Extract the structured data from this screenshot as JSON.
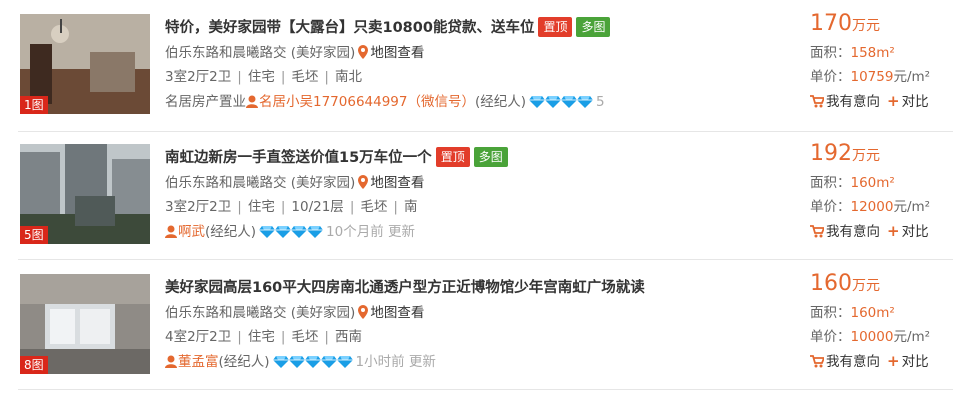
{
  "listings": [
    {
      "photo_count": "1图",
      "title": "特价，美好家园带【大露台】只卖10800能贷款、送车位",
      "tags": [
        "置顶",
        "多图"
      ],
      "location": "伯乐东路和晨曦路交 (美好家园)",
      "map_link": "地图查看",
      "attrs": [
        "3室2厅2卫",
        "住宅",
        "毛坯",
        "南北"
      ],
      "agency": "名居房产置业",
      "agent_name": "名居小吴17706644997（微信号）",
      "agent_role": "(经纪人)",
      "diamond_count": 4,
      "agent_extra": "5",
      "price": "170",
      "price_unit": "万元",
      "area_label": "面积：",
      "area": "158m²",
      "unit_price_label": "单价：",
      "unit_price": "10759",
      "unit_price_suffix": "元/m²",
      "interest_label": "我有意向",
      "compare_label": "对比"
    },
    {
      "photo_count": "5图",
      "title": "南虹边新房一手直签送价值15万车位一个",
      "tags": [
        "置顶",
        "多图"
      ],
      "location": "伯乐东路和晨曦路交 (美好家园)",
      "map_link": "地图查看",
      "attrs": [
        "3室2厅2卫",
        "住宅",
        "10/21层",
        "毛坯",
        "南"
      ],
      "agency": "",
      "agent_name": "啊武",
      "agent_role": "(经纪人)",
      "diamond_count": 4,
      "agent_extra": "10个月前 更新",
      "price": "192",
      "price_unit": "万元",
      "area_label": "面积：",
      "area": "160m²",
      "unit_price_label": "单价：",
      "unit_price": "12000",
      "unit_price_suffix": "元/m²",
      "interest_label": "我有意向",
      "compare_label": "对比"
    },
    {
      "photo_count": "8图",
      "title": "美好家园高层160平大四房南北通透户型方正近博物馆少年宫南虹广场就读",
      "tags": [],
      "location": "伯乐东路和晨曦路交 (美好家园)",
      "map_link": "地图查看",
      "attrs": [
        "4室2厅2卫",
        "住宅",
        "毛坯",
        "西南"
      ],
      "agency": "",
      "agent_name": "董孟富",
      "agent_role": "(经纪人)",
      "diamond_count": 5,
      "agent_extra": "1小时前 更新",
      "price": "160",
      "price_unit": "万元",
      "area_label": "面积：",
      "area": "160m²",
      "unit_price_label": "单价：",
      "unit_price": "10000",
      "unit_price_suffix": "元/m²",
      "interest_label": "我有意向",
      "compare_label": "对比"
    }
  ],
  "colors": {
    "accent": "#e4682f",
    "tag_top": "#e23d2a",
    "tag_pics": "#4aa339",
    "photo_badge": "#d9271a",
    "diamond": "#1a9ee6"
  },
  "icons": {
    "map": "map-pin-icon",
    "agent": "person-icon",
    "badge": "diamond-icon",
    "interest": "cart-icon",
    "compare": "plus-icon"
  }
}
